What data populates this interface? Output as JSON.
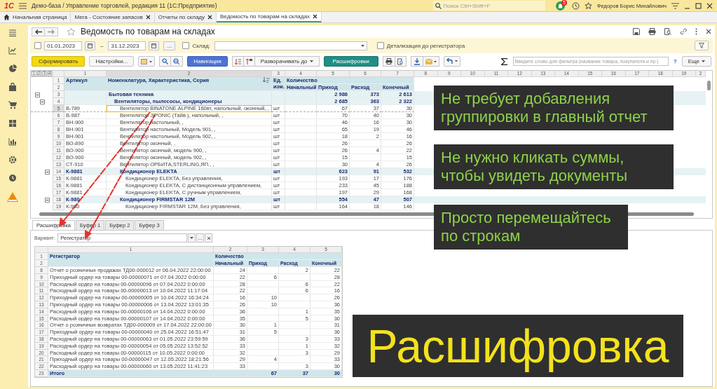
{
  "app": {
    "logo": "1С",
    "title": "Демо-база / Управление торговлей, редакция 11  (1С:Предприятие)",
    "search": {
      "placeholder": "Поиск Ctrl+Shift+F"
    },
    "notifications": "5",
    "user": "Федоров Борис Михайлович"
  },
  "tabs": [
    {
      "label": "Начальная страница",
      "kind": "home",
      "selected": false
    },
    {
      "label": "Мега - Состояние запасов",
      "kind": "closable",
      "selected": false
    },
    {
      "label": "Отчеты по складу",
      "kind": "closable",
      "selected": false
    },
    {
      "label": "Ведомость по товарам на складах",
      "kind": "closable",
      "selected": true
    }
  ],
  "report": {
    "title": "Ведомость по товарам на складах",
    "period": {
      "checked": false,
      "from": "01.01.2023",
      "dash": "–",
      "to": "31.12.2023",
      "more": "..."
    },
    "warehouse": {
      "checked": false,
      "label": "Склад:"
    },
    "detail": {
      "checked": false,
      "label": "Детализация до регистратора"
    }
  },
  "toolbar": {
    "generate": "Сформировать",
    "settings": "Настройки...",
    "navigation": "Навигация",
    "expand": "Разворачивать до",
    "details": "Расшифровки",
    "filter": {
      "placeholder": "Введите слово для фильтра (название товара, покупателя и пр.)"
    },
    "help": "?",
    "more": "Еще"
  },
  "main_table": {
    "levels": [
      "1",
      "2",
      "3",
      "4"
    ],
    "column_numbers": [
      "1",
      "2",
      "3",
      "4",
      "5",
      "6",
      "7",
      "8",
      "9",
      "10",
      "11",
      "12",
      "13",
      "14",
      "15",
      "16",
      "17",
      "18",
      "19",
      "2"
    ],
    "header_rows": [
      "1",
      "2"
    ],
    "header": {
      "article": "Артикул",
      "name": "Номенклатура, Характеристика, Серия",
      "unit": "Ед. изм.",
      "quantity": "Количество",
      "start": "Начальный",
      "in": "Приход",
      "out": "Расход",
      "end": "Конечный"
    },
    "rows": [
      {
        "num": "3",
        "name": "Бытовая техника",
        "in": "2 986",
        "out": "373",
        "end": "2 613",
        "selected": false,
        "expanded": true,
        "children": [
          {
            "num": "4",
            "name": "Вентиляторы, пылесосы, кондиционеры",
            "in": "2 685",
            "out": "363",
            "end": "2 322",
            "selected": false,
            "expanded": true,
            "children": [
              {
                "num": "5",
                "article": "В-789",
                "name": "Вентилятор BINATONE ALPINE 160вт, напольный, оконный, ,",
                "unit": "шт",
                "in": "67",
                "out": "37",
                "end": "30",
                "selected": true
              },
              {
                "num": "6",
                "article": "В-987",
                "name": "Вентилятор JIPONIC (Тайв.), напольный, ,",
                "unit": "шт",
                "in": "70",
                "out": "40",
                "end": "30",
                "selected": false
              },
              {
                "num": "7",
                "article": "ВН-900",
                "name": "Вентилятор настольный, ,",
                "unit": "шт",
                "in": "46",
                "out": "16",
                "end": "30",
                "selected": false
              },
              {
                "num": "8",
                "article": "ВН-901",
                "name": "Вентилятор настольный, Модель 901, ,",
                "unit": "шт",
                "in": "65",
                "out": "19",
                "end": "46",
                "selected": false
              },
              {
                "num": "9",
                "article": "ВН-901",
                "name": "Вентилятор настольный, Модель 902, ,",
                "unit": "шт",
                "in": "18",
                "out": "2",
                "end": "16",
                "selected": false
              },
              {
                "num": "10",
                "article": "ВО-890",
                "name": "Вентилятор оконный, ,",
                "unit": "шт",
                "in": "26",
                "end": "26",
                "selected": false
              },
              {
                "num": "11",
                "article": "ВО-900",
                "name": "Вентилятор оконный, модель 900, ,",
                "unit": "шт",
                "in": "26",
                "out": "4",
                "end": "22",
                "selected": false
              },
              {
                "num": "12",
                "article": "ВО-900",
                "name": "Вентилятор оконный, модель 902, ,",
                "unit": "шт",
                "in": "15",
                "end": "15",
                "selected": false
              },
              {
                "num": "13",
                "article": "СТ-910",
                "name": "Вентилятор ОРБИТА,STERLING,ЯП., ,",
                "unit": "шт",
                "in": "30",
                "out": "4",
                "end": "26",
                "selected": false
              },
              {
                "num": "14",
                "article": "К-9881",
                "name": "Кондиционер ELEKTA",
                "unit": "шт",
                "in": "623",
                "out": "91",
                "end": "532",
                "selected": false,
                "expanded": true,
                "children": [
                  {
                    "num": "15",
                    "article": "К-9881",
                    "name": "Кондиционер ELEKTA, Без управления,",
                    "unit": "шт",
                    "in": "193",
                    "out": "17",
                    "end": "176",
                    "selected": false
                  },
                  {
                    "num": "16",
                    "article": "К-9881",
                    "name": "Кондиционер ELEKTA, С дистанционным управлением,",
                    "unit": "шт",
                    "in": "233",
                    "out": "45",
                    "end": "188",
                    "selected": false
                  },
                  {
                    "num": "17",
                    "article": "К-9881",
                    "name": "Кондиционер ELEKTA, С ручным управлением,",
                    "unit": "шт",
                    "in": "197",
                    "out": "29",
                    "end": "168",
                    "selected": false
                  }
                ]
              },
              {
                "num": "18",
                "article": "К-980",
                "name": "Кондиционер FIRMSTAR 12M",
                "unit": "шт",
                "in": "554",
                "out": "47",
                "end": "507",
                "selected": false,
                "expanded": true,
                "children": [
                  {
                    "num": "19",
                    "article": "К-980",
                    "name": "Кондиционер FIRMSTAR 12M, Без управления,",
                    "unit": "шт",
                    "in": "164",
                    "out": "18",
                    "end": "146",
                    "selected": false
                  }
                ]
              }
            ]
          }
        ]
      }
    ]
  },
  "detail_panel": {
    "tabs": [
      {
        "label": "Расшифровка",
        "selected": true
      },
      {
        "label": "Буфер 1",
        "selected": false
      },
      {
        "label": "Буфер 2",
        "selected": false
      },
      {
        "label": "Буфер 3",
        "selected": false
      }
    ],
    "variant": {
      "label": "Вариант:",
      "value": "Регистратор",
      "more": "..."
    },
    "table": {
      "column_numbers": [
        "1",
        "2",
        "3",
        "4",
        "5"
      ],
      "header_rows": [
        "1",
        "2"
      ],
      "header": {
        "registrar": "Регистратор",
        "quantity": "Количество",
        "start": "Начальный",
        "in": "Приход",
        "out": "Расход",
        "end": "Конечный"
      },
      "rows": [
        {
          "num": "8",
          "kind": "entry",
          "doc": "Отчет о розничных продажах ТД00-000012 от 06.04.2022 22:00:00",
          "start": "24",
          "out": "2",
          "end": "22"
        },
        {
          "num": "9",
          "kind": "entry",
          "doc": "Приходный ордер на товары 00-00000071 от 07.04.2022 0:00:00",
          "start": "22",
          "in": "6",
          "end": "28"
        },
        {
          "num": "10",
          "kind": "entry",
          "doc": "Расходный ордер на товары 00-00000096 от 07.04.2022 0:00:00",
          "start": "28",
          "out": "6",
          "end": "22"
        },
        {
          "num": "11",
          "kind": "entry",
          "doc": "Расходный ордер на товары 00-00000013 от 10.04.2022 11:17:04",
          "start": "22",
          "out": "6",
          "end": "16"
        },
        {
          "num": "12",
          "kind": "entry",
          "doc": "Приходный ордер на товары 00-00000005 от 10.04.2022 16:34:24",
          "start": "16",
          "in": "10",
          "end": "26"
        },
        {
          "num": "13",
          "kind": "entry",
          "doc": "Приходный ордер на товары 00-00000006 от 13.04.2022 13:01:35",
          "start": "26",
          "in": "10",
          "end": "36"
        },
        {
          "num": "14",
          "kind": "entry",
          "doc": "Расходный ордер на товары 00-00000106 от 14.04.2022 0:00:00",
          "start": "36",
          "out": "1",
          "end": "35"
        },
        {
          "num": "15",
          "kind": "entry",
          "doc": "Расходный ордер на товары 00-00000107 от 14.04.2022 0:00:00",
          "start": "35",
          "out": "5",
          "end": "30"
        },
        {
          "num": "16",
          "kind": "entry",
          "doc": "Отчет о розничных возвратах ТД00-000009 от 17.04.2022 22:00:00",
          "start": "30",
          "in": "1",
          "end": "31"
        },
        {
          "num": "17",
          "kind": "entry",
          "doc": "Приходный ордер на товары 00-00000040 от 25.04.2022 16:51:47",
          "start": "31",
          "in": "5",
          "end": "36"
        },
        {
          "num": "18",
          "kind": "entry",
          "doc": "Расходный ордер на товары 00-00000063 от 01.05.2022 23:59:59",
          "start": "36",
          "out": "3",
          "end": "33"
        },
        {
          "num": "19",
          "kind": "entry",
          "doc": "Расходный ордер на товары 00-00000054 от 05.05.2022 13:52:52",
          "start": "33",
          "out": "1",
          "end": "32"
        },
        {
          "num": "20",
          "kind": "entry",
          "doc": "Расходный ордер на товары 00-00000115 от 10.05.2022 0:00:00",
          "start": "32",
          "out": "3",
          "end": "29"
        },
        {
          "num": "21",
          "kind": "entry",
          "doc": "Приходный ордер на товары 00-00000047 от 12.05.2022 18:21:56",
          "start": "29",
          "in": "4",
          "end": "33"
        },
        {
          "num": "22",
          "kind": "entry",
          "doc": "Расходный ордер на товары 00-00000060 от 13.05.2022 11:41:23",
          "start": "33",
          "out": "3",
          "end": "30"
        },
        {
          "num": "23",
          "kind": "total",
          "doc": "Итого",
          "in": "67",
          "out": "37",
          "end": "30"
        }
      ]
    }
  },
  "callouts": [
    {
      "text": "Не требует добавления группировки в главный отчет"
    },
    {
      "text": "Не нужно кликать суммы, чтобы увидеть документы"
    },
    {
      "text": "Просто перемещайтесь по строкам"
    }
  ],
  "banner": "Расшифровка"
}
